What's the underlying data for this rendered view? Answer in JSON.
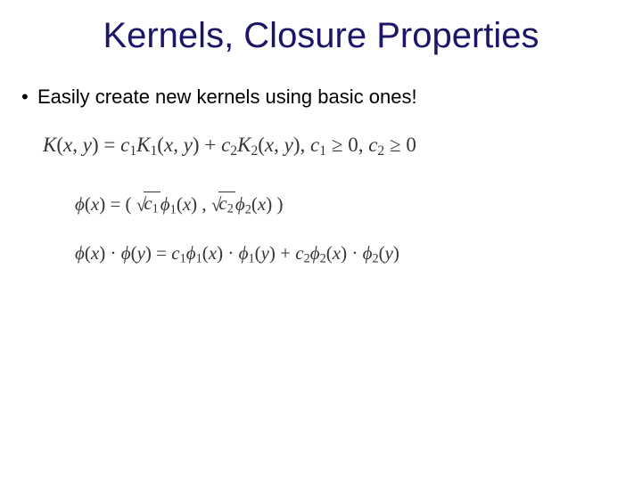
{
  "title": {
    "text": "Kernels, Closure Properties",
    "color": "#1b1668"
  },
  "bullet": {
    "text": "Easily create new kernels using basic ones!"
  },
  "equations": {
    "eq1": {
      "K": "K",
      "open": "(",
      "x": "x",
      "comma": ", ",
      "y": "y",
      "close": ")",
      "eq": " = ",
      "c1": "c",
      "c1_sub": "1",
      "K1": "K",
      "K1_sub": "1",
      "plus": " + ",
      "c2": "c",
      "c2_sub": "2",
      "K2": "K",
      "K2_sub": "2",
      "sep": ", ",
      "ge": " ≥ ",
      "zero": "0"
    },
    "eq2": {
      "phi": "ϕ",
      "open": "(",
      "x": "x",
      "close": ")",
      "eq": " = ",
      "bigO": "( ",
      "bigC": " )",
      "c": "c",
      "sub1": "1",
      "sub2": "2",
      "phi1": "ϕ",
      "phi2": "ϕ",
      "comma_mid": " , "
    },
    "eq3": {
      "phi": "ϕ",
      "x": "x",
      "y": "y",
      "dot": " · ",
      "eq": " = ",
      "c": "c",
      "sub1": "1",
      "sub2": "2",
      "plus": " + "
    }
  }
}
